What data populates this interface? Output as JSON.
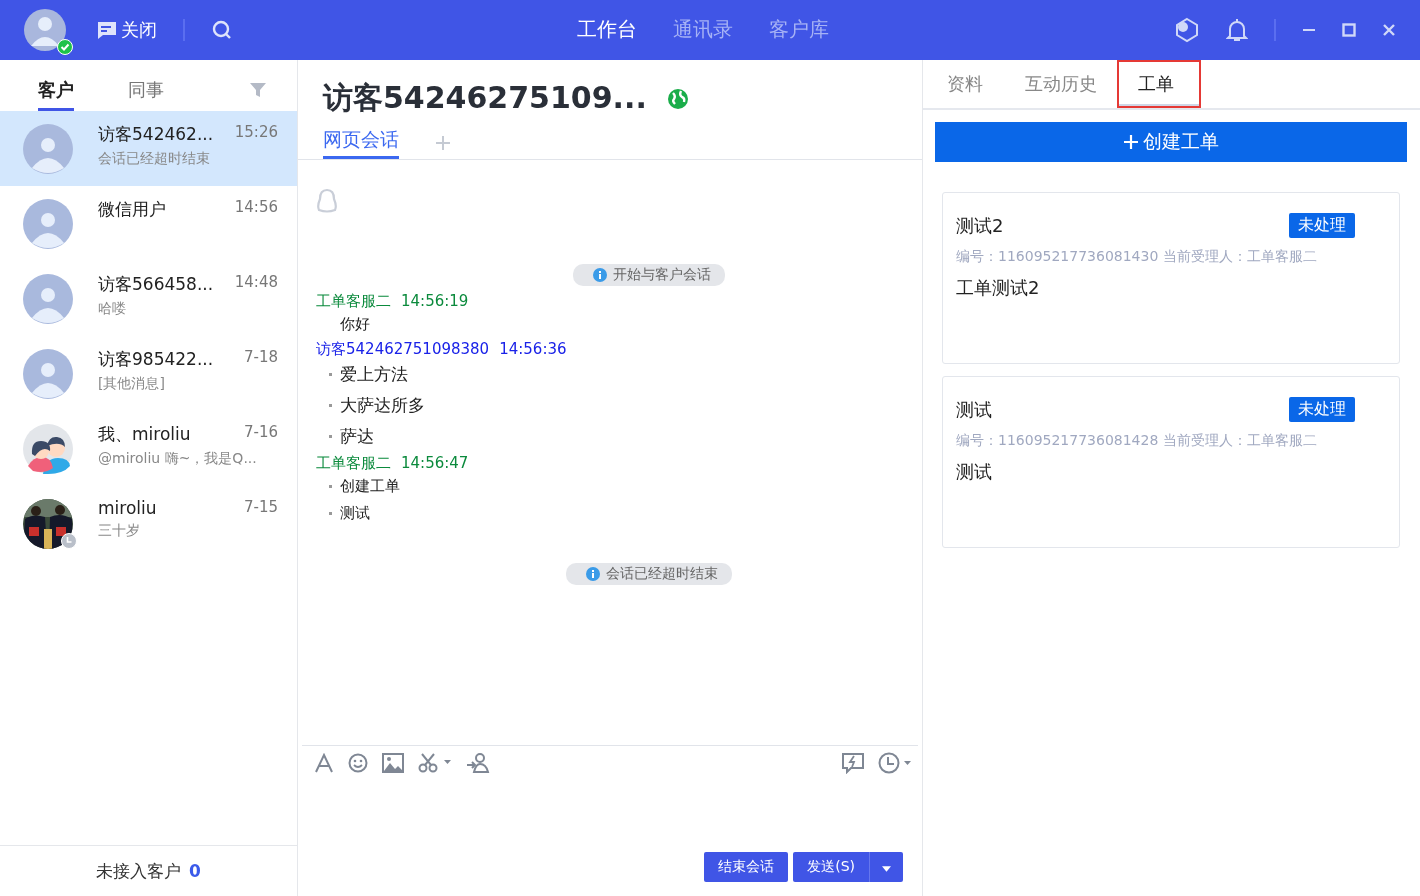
{
  "topbar": {
    "online": true,
    "close_label": "关闭",
    "nav": [
      {
        "label": "工作台",
        "selected": true
      },
      {
        "label": "通讯录",
        "selected": false
      },
      {
        "label": "客户库",
        "selected": false
      }
    ]
  },
  "sidebar": {
    "tabs": [
      {
        "label": "客户",
        "selected": true
      },
      {
        "label": "同事",
        "selected": false
      }
    ],
    "items": [
      {
        "name": "访客542462...",
        "time": "15:26",
        "preview": "会话已经超时结束",
        "kind": "default",
        "away": false,
        "selected": true
      },
      {
        "name": "微信用户",
        "time": "14:56",
        "kind": "default",
        "away": false,
        "selected": false
      },
      {
        "name": "访客566458...",
        "time": "14:48",
        "preview": "哈喽",
        "kind": "default",
        "away": false,
        "selected": false
      },
      {
        "name": "访客985422...",
        "time": "7-18",
        "preview": "[其他消息]",
        "kind": "default",
        "away": false,
        "selected": false
      },
      {
        "name": "我、miroliu",
        "time": "7-16",
        "preview": "@miroliu 嗨~，我是Q...",
        "kind": "group",
        "away": false,
        "selected": false
      },
      {
        "name": "miroliu",
        "time": "7-15",
        "preview": "三十岁",
        "away": true,
        "selected": false
      }
    ],
    "footer_label": "未接入客户",
    "footer_count": "0"
  },
  "chat": {
    "title": "访客54246275109...",
    "tabs": [
      {
        "label": "网页会话",
        "selected": true
      }
    ],
    "messages": [
      {
        "kind": "system",
        "text": "开始与客户会话"
      },
      {
        "kind": "agent",
        "sender": "工单客服二",
        "time": "14:56:19"
      },
      {
        "kind": "text",
        "bullet": false,
        "large": false,
        "text": "你好"
      },
      {
        "kind": "visitor",
        "sender": "访客542462751098380",
        "time": "14:56:36"
      },
      {
        "kind": "text",
        "bullet": true,
        "large": true,
        "text": "爱上方法"
      },
      {
        "kind": "text",
        "bullet": true,
        "large": true,
        "text": "大萨达所多"
      },
      {
        "kind": "text",
        "bullet": true,
        "large": true,
        "text": "萨达"
      },
      {
        "kind": "agent",
        "sender": "工单客服二",
        "time": "14:56:47"
      },
      {
        "kind": "text",
        "bullet": true,
        "large": false,
        "text": "创建工单"
      },
      {
        "kind": "text",
        "bullet": true,
        "large": false,
        "text": "测试"
      },
      {
        "kind": "system",
        "text": "会话已经超时结束"
      }
    ],
    "end_button": "结束会话",
    "send_button": "发送(S)"
  },
  "panel": {
    "tabs": [
      {
        "label": "资料",
        "selected": false,
        "highlighted": false
      },
      {
        "label": "互动历史",
        "selected": false,
        "highlighted": false
      },
      {
        "label": "工单",
        "selected": true,
        "highlighted": true
      }
    ],
    "create_button": "创建工单",
    "tickets": [
      {
        "title": "测试2",
        "status": "未处理",
        "meta": "编号：116095217736081430 当前受理人：工单客服二",
        "body": "工单测试2"
      },
      {
        "title": "测试",
        "status": "未处理",
        "meta": "编号：116095217736081428 当前受理人：工单客服二",
        "body": "测试"
      }
    ]
  }
}
